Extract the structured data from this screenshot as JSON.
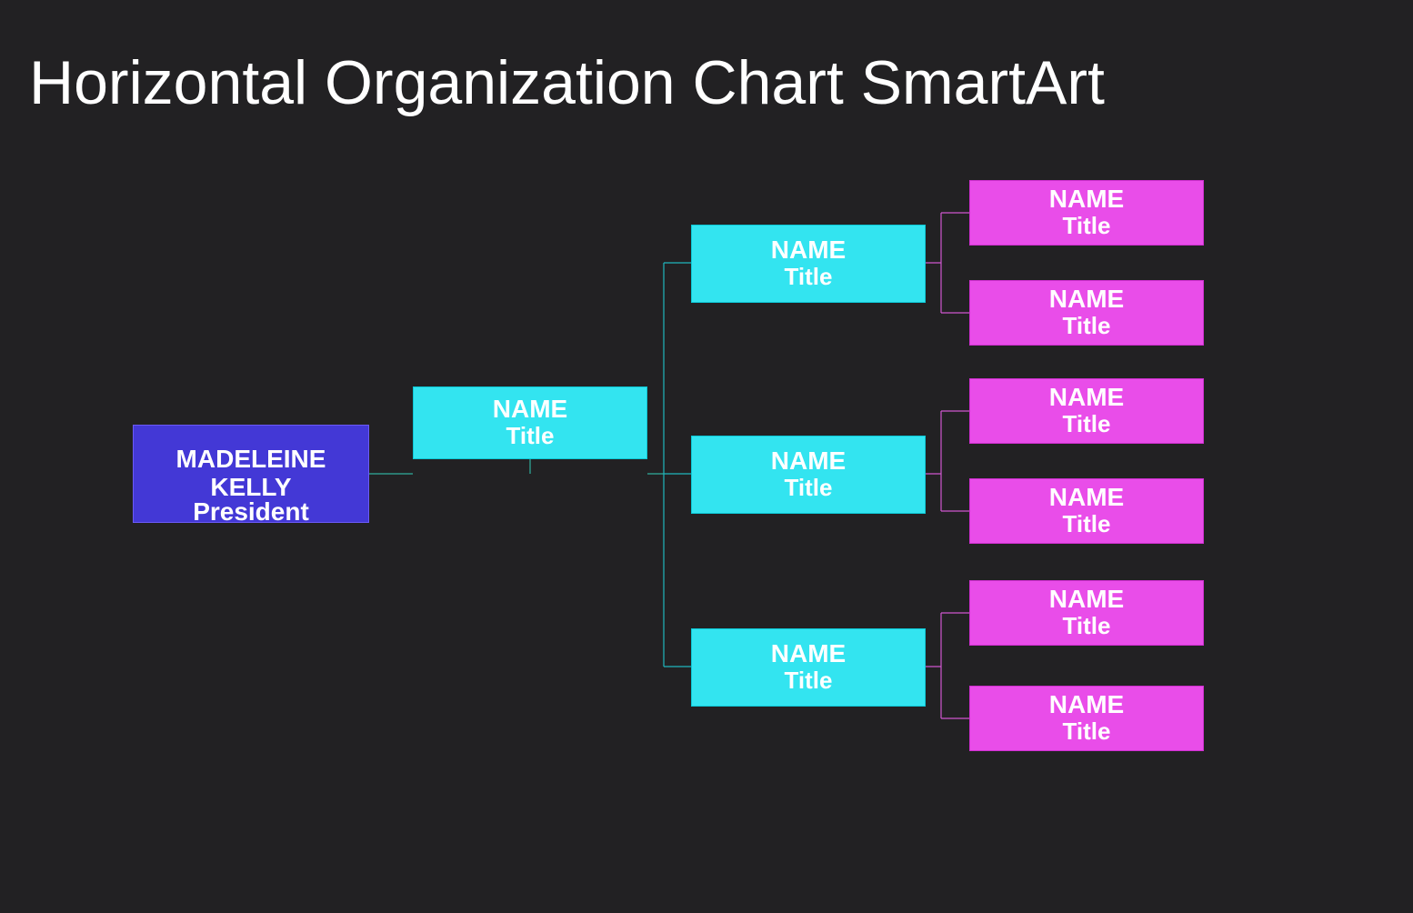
{
  "title": "Horizontal Organization Chart SmartArt",
  "colors": {
    "bg": "#222123",
    "root": "#4338d6",
    "cyan": "#33e4f0",
    "magenta": "#e94de9"
  },
  "org": {
    "root": {
      "name": "MADELEINE KELLY",
      "title": "President"
    },
    "level2": {
      "name": "NAME",
      "title": "Title"
    },
    "level3": [
      {
        "name": "NAME",
        "title": "Title"
      },
      {
        "name": "NAME",
        "title": "Title"
      },
      {
        "name": "NAME",
        "title": "Title"
      }
    ],
    "level4": [
      [
        {
          "name": "NAME",
          "title": "Title"
        },
        {
          "name": "NAME",
          "title": "Title"
        }
      ],
      [
        {
          "name": "NAME",
          "title": "Title"
        },
        {
          "name": "NAME",
          "title": "Title"
        }
      ],
      [
        {
          "name": "NAME",
          "title": "Title"
        },
        {
          "name": "NAME",
          "title": "Title"
        }
      ]
    ]
  }
}
